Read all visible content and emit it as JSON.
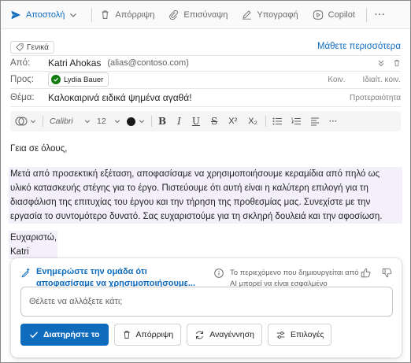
{
  "toolbar": {
    "send_label": "Αποστολή",
    "discard_label": "Απόρριψη",
    "attach_label": "Επισύναψη",
    "signature_label": "Υπογραφή",
    "copilot_label": "Copilot",
    "more_label": "···"
  },
  "header": {
    "sensitivity_label": "Γενικά",
    "learn_more": "Μάθετε περισσότερα",
    "from_label": "Από:",
    "from_name": "Katri Ahokas",
    "from_email": "(alias@contoso.com)",
    "to_label": "Προς:",
    "to_recipient": "Lydia Bauer",
    "cc_label": "Κοιν.",
    "bcc_label": "Ιδιαίτ. κοιν.",
    "subject_label": "Θέμα:",
    "subject_value": "Καλοκαιρινά ειδικά ψημένα αγαθά!",
    "priority_label": "Προτεραιότητα"
  },
  "format_bar": {
    "font_name": "Calibri",
    "font_size": "12",
    "bold": "B",
    "italic": "I",
    "underline": "U",
    "strike": "S",
    "superscript": "X²",
    "subscript": "X₂",
    "text_color": "#1a1a1a"
  },
  "body": {
    "greeting": "Γεια σε όλους,",
    "paragraph": "Μετά από προσεκτική εξέταση, αποφασίσαμε να χρησιμοποιήσουμε κεραμίδια από πηλό ως υλικό κατασκευής στέγης για το έργο. Πιστεύουμε ότι αυτή είναι η καλύτερη επιλογή για τη διασφάλιση της επιτυχίας του έργου και την τήρηση της προθεσμίας μας. Συνεχίστε με την εργασία το συντομότερο δυνατό. Σας ευχαριστούμε για τη σκληρή δουλειά και την αφοσίωση.",
    "closing": "Ευχαριστώ,",
    "signature": "Katri"
  },
  "copilot": {
    "title": "Ενημερώστε την ομάδα ότι αποφασίσαμε να χρησιμοποιήσουμε...",
    "ai_note": "Το περιεχόμενο που δημιουργείται από AI μπορεί να είναι εσφαλμένο",
    "prompt_placeholder": "Θέλετε να αλλάξετε κάτι;",
    "keep_label": "Διατηρήστε το",
    "discard_label": "Απόρριψη",
    "regenerate_label": "Αναγέννηση",
    "options_label": "Επιλογές"
  },
  "colors": {
    "accent": "#0f6cbd",
    "highlight": "#f4f0fb",
    "presence": "#107c10"
  }
}
